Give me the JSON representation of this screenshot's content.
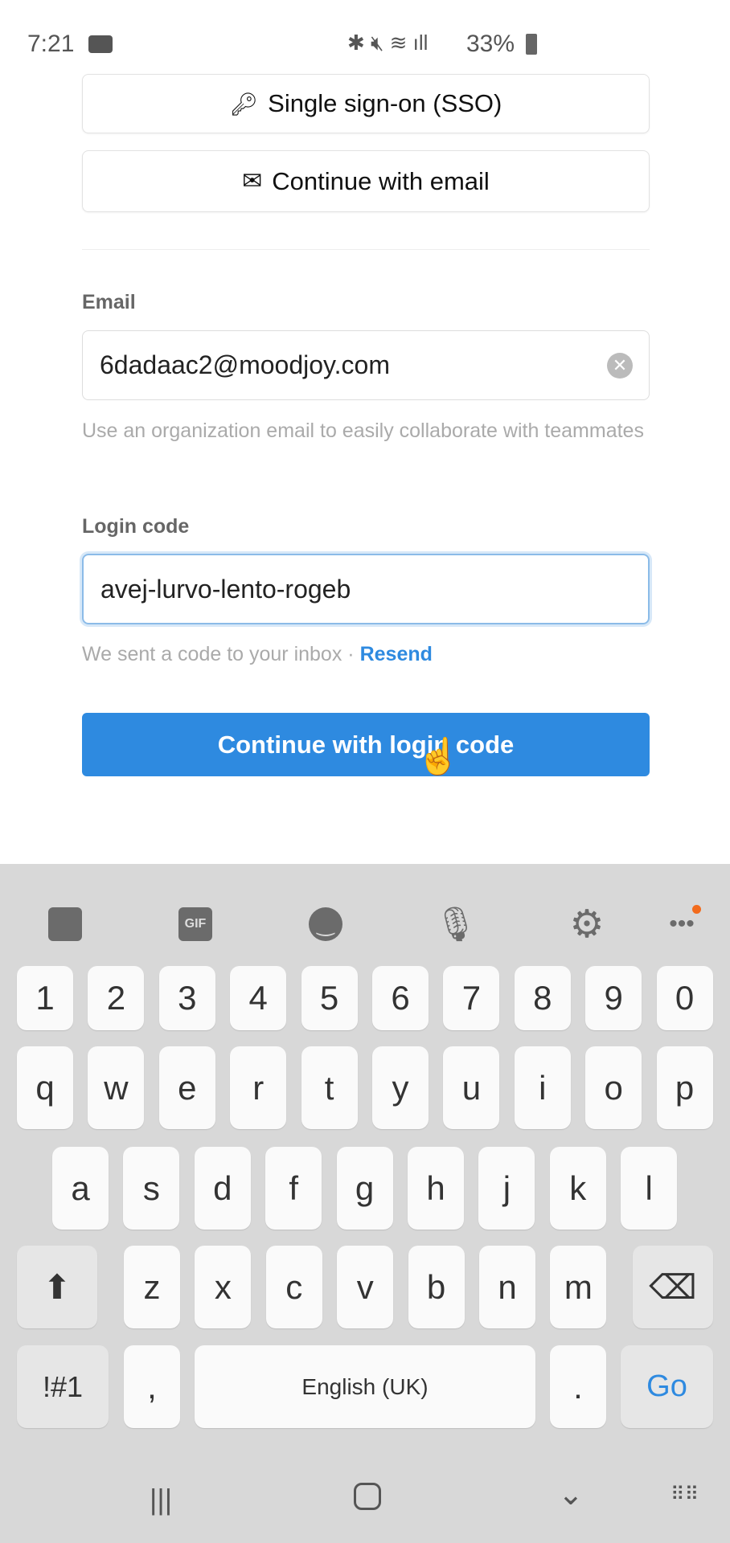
{
  "status_bar": {
    "time": "7:21",
    "battery": "33%"
  },
  "sso_button": "Single sign-on (SSO)",
  "email_button": "Continue with email",
  "email": {
    "label": "Email",
    "value": "6dadaac2@moodjoy.com",
    "helper": "Use an organization email to easily collaborate with teammates"
  },
  "login_code": {
    "label": "Login code",
    "value": "avej-lurvo-lento-rogeb",
    "helper": "We sent a code to your inbox ·",
    "resend": "Resend"
  },
  "submit_button": "Continue with login code",
  "colors": {
    "accent": "#2e8ae0",
    "keyboard_bg": "#d8d8d8",
    "notification_dot": "#f26b1d"
  },
  "keyboard": {
    "toolbar": [
      "sticker-icon",
      "gif-icon",
      "emoji-icon",
      "mic-icon",
      "settings-icon",
      "more-icon"
    ],
    "gif": "GIF",
    "row_numbers": [
      "1",
      "2",
      "3",
      "4",
      "5",
      "6",
      "7",
      "8",
      "9",
      "0"
    ],
    "row_q": [
      "q",
      "w",
      "e",
      "r",
      "t",
      "y",
      "u",
      "i",
      "o",
      "p"
    ],
    "row_a": [
      "a",
      "s",
      "d",
      "f",
      "g",
      "h",
      "j",
      "k",
      "l"
    ],
    "row_z": [
      "z",
      "x",
      "c",
      "v",
      "b",
      "n",
      "m"
    ],
    "symbols": "!#1",
    "comma": ",",
    "space": "English (UK)",
    "period": ".",
    "go": "Go"
  }
}
